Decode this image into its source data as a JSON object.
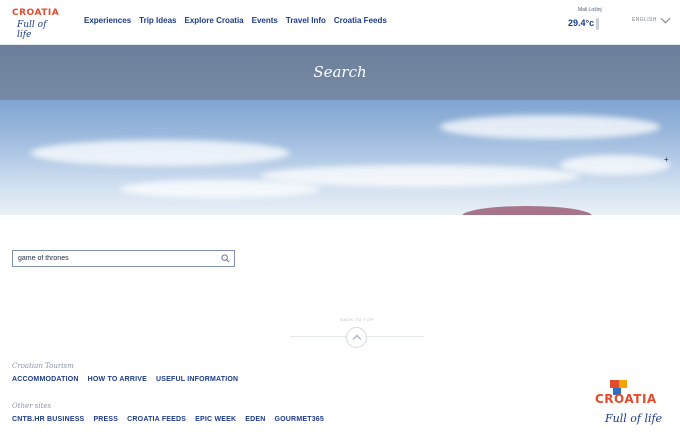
{
  "header": {
    "logo_word": "CROATIA",
    "logo_slogan": "Full of life",
    "nav": [
      "Experiences",
      "Trip Ideas",
      "Explore Croatia",
      "Events",
      "Travel Info",
      "Croatia Feeds"
    ],
    "weather": {
      "city": "Mali Lošinj",
      "temp": "29.4°c"
    },
    "language": "ENGLISH"
  },
  "hero": {
    "title": "Search"
  },
  "search": {
    "value": "game of thrones"
  },
  "back_to_top": "BACK TO TOP",
  "footer": {
    "groups": [
      {
        "heading": "Croatian Tourism",
        "links": [
          "ACCOMMODATION",
          "HOW TO ARRIVE",
          "USEFUL INFORMATION"
        ]
      },
      {
        "heading": "Other sites",
        "links": [
          "CNTB.HR BUSINESS",
          "PRESS",
          "CROATIA FEEDS",
          "EPIC WEEK",
          "EDEN",
          "GOURMET365"
        ]
      }
    ],
    "logo_word": "CROATIA",
    "logo_slogan": "Full of life"
  },
  "colors": {
    "brand_blue": "#1d3b8a",
    "brand_red": "#e14b2e",
    "brand_orange": "#f4a300"
  }
}
